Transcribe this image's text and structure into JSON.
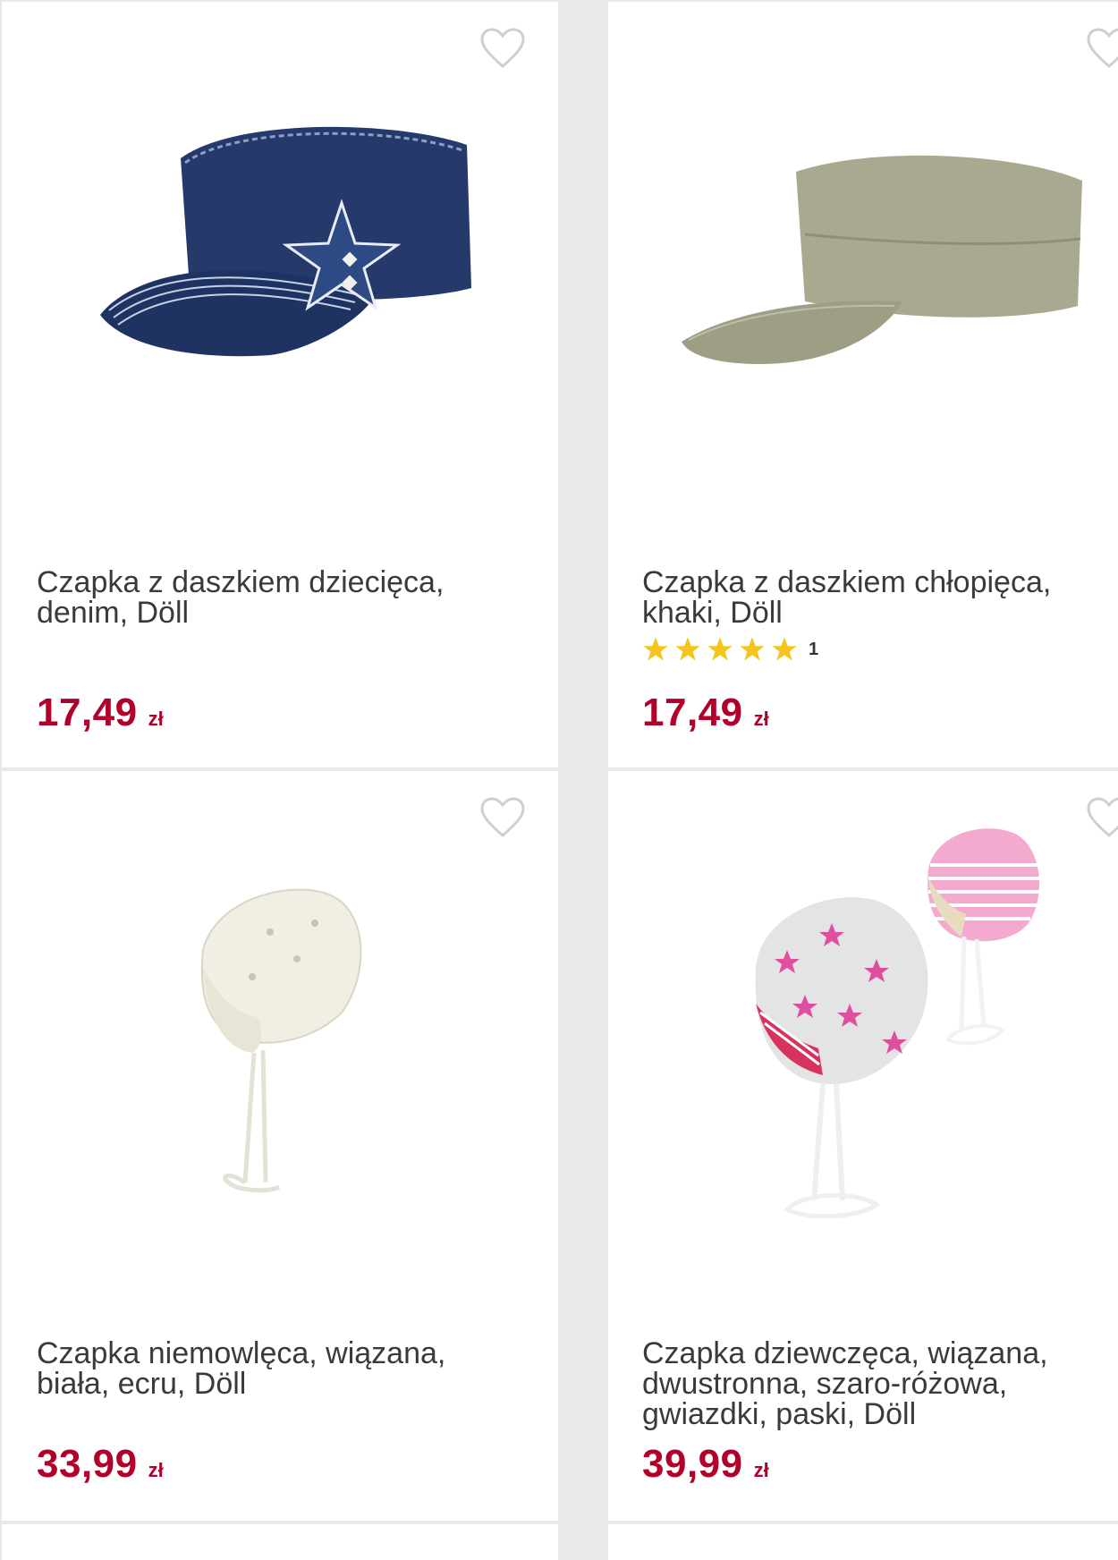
{
  "products": [
    {
      "title": "Czapka z daszkiem dziecięca, denim, Döll",
      "price": "17,49",
      "currency": "zł",
      "image": "denim-cap-with-star"
    },
    {
      "title": "Czapka z daszkiem chłopięca, khaki, Döll",
      "price": "17,49",
      "currency": "zł",
      "rating": 5,
      "rating_count": "1",
      "image": "khaki-cap"
    },
    {
      "title": "Czapka niemowlęca, wiązana, biała, ecru, Döll",
      "price": "33,99",
      "currency": "zł",
      "image": "white-baby-bonnet"
    },
    {
      "title": "Czapka dziewczęca, wiązana, dwustronna, szaro-różowa, gwiazdki, paski, Döll",
      "price": "39,99",
      "currency": "zł",
      "image": "grey-pink-bonnets"
    }
  ],
  "colors": {
    "price": "#b2002a",
    "star": "#f5c51c",
    "heart": "#cfcfcf"
  }
}
